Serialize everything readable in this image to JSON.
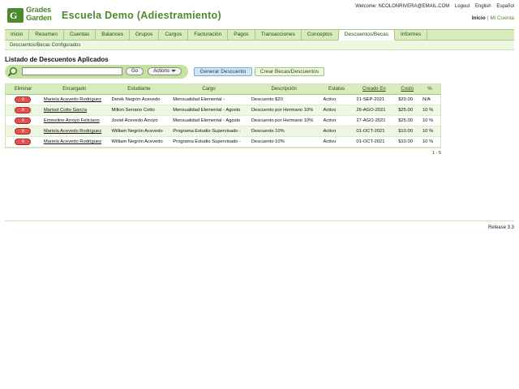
{
  "header": {
    "logo_line1": "Grades",
    "logo_line2": "Garden",
    "logo_mark": "G",
    "school_name": "Escuela Demo (Adiestramiento)",
    "welcome": "Welcome: NCOLONRIVERA@EMAIL.COM",
    "logout": "Logout",
    "english": "English",
    "espanol": "Español",
    "inicio": "Inicio",
    "separator": "|",
    "mi_cuenta": "Mi Cuenta"
  },
  "nav": {
    "items": [
      "Inicio",
      "Resumen",
      "Cuentas",
      "Balances",
      "Grupos",
      "Cargos",
      "Facturación",
      "Pagos",
      "Transacciones",
      "Conceptos",
      "Descuentos/Becas",
      "Informes"
    ],
    "active_index": 10
  },
  "subnav": {
    "label": "Descuentos/Becas Configurados"
  },
  "page": {
    "title": "Listado de Descuentos Aplicados"
  },
  "toolbar": {
    "search_placeholder": "",
    "search_value": "",
    "go_label": "Go",
    "actions_label": "Actions",
    "generar_label": "Generar Descuento",
    "crear_label": "Crear Becas/Descuentos"
  },
  "table": {
    "headers": [
      "Eliminar",
      "Encargado",
      "Estudiante",
      "Cargo",
      "Descripción",
      "Estatus",
      "Creado En",
      "Costo",
      "%"
    ],
    "delete_label": "X",
    "rows": [
      [
        "Mariela Acevedo Rodríguez",
        "Derek Negrón Acevedo",
        "Mensualidad Elemental -",
        "Descuento $20",
        "Activo",
        "21-SEP-2021",
        "$20.00",
        "N/A"
      ],
      [
        "Marisol Cotto García",
        "Milton Serrano Cotto",
        "Mensualidad Elemental - Agosto",
        "Descuento por Hermano 10%",
        "Activo",
        "26-AGO-2021",
        "$25.00",
        "10 %"
      ],
      [
        "Emmeline Arroyo Feliciano",
        "Joviel Acevedo Arroyo",
        "Mensualidad Elemental - Agosto",
        "Descuento por Hermano 10%",
        "Activo",
        "27-AGO-2021",
        "$25.00",
        "10 %"
      ],
      [
        "Mariela Acevedo Rodríguez",
        "William Negrón Acevedo",
        "Programa Estudio Supervisado -",
        "Descuento 10%",
        "Activo",
        "01-OCT-2021",
        "$10.00",
        "10 %"
      ],
      [
        "Mariela Acevedo Rodríguez",
        "William Negrón Acevedo",
        "Programa Estudio Supervisado -",
        "Descuento 10%",
        "Activo",
        "01-OCT-2021",
        "$10.00",
        "10 %"
      ]
    ]
  },
  "pager": {
    "text": "1 - 5"
  },
  "footer": {
    "release": "Release 3.3"
  },
  "colors": {
    "brand_green": "#4d8a2c",
    "nav_bg": "#d7ebbc",
    "delete_red": "#e05454",
    "primary_blue": "#cfe6f7"
  },
  "icons": {
    "search": "search-icon",
    "actions_caret": "chevron-down-icon",
    "logo": "grades-garden-logo-icon"
  }
}
